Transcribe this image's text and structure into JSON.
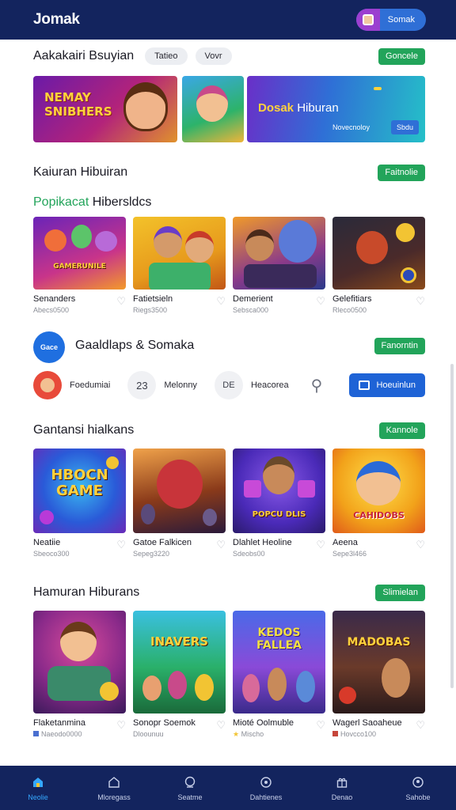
{
  "header": {
    "brand": "Jomak",
    "account_label": "Somak"
  },
  "featured": {
    "title": "Aakakairi Bsuyian",
    "chips": [
      "Tatieo",
      "Vovr"
    ],
    "button": "Goncele",
    "banner1_text": "NEMAY SNIBHERS",
    "banner3_title_a": "Dosak",
    "banner3_title_b": "Hiburan",
    "banner3_tag": "",
    "banner3_small": "Novecnoloy",
    "banner3_btn": "Sbdu"
  },
  "section_hiburan": {
    "title": "Kaiuran Hibuiran",
    "button": "Faitnolie"
  },
  "popular": {
    "title_green": "Popikacat",
    "title_rest": "Hibersldcs",
    "games": [
      {
        "name": "Senanders",
        "sub": "Abecs0500",
        "art": "GAMERUNILE"
      },
      {
        "name": "Fatietsieln",
        "sub": "Riegs3500",
        "art": ""
      },
      {
        "name": "Demerient",
        "sub": "Sebsca000",
        "art": ""
      },
      {
        "name": "Gelefitiars",
        "sub": "Rleco0500",
        "art": ""
      }
    ]
  },
  "providers": {
    "title": "Gaaldlaps & Somaka",
    "button": "Fanorntin",
    "logo_text": "Gace",
    "items": [
      {
        "label": "Foedumiai",
        "icon": ""
      },
      {
        "label": "Melonny",
        "icon": "23"
      },
      {
        "label": "Heacorea",
        "icon": "DE"
      }
    ],
    "cta": "Hoeuinlun"
  },
  "section_games": {
    "title": "Gantansi hialkans",
    "button": "Kannole",
    "games": [
      {
        "name": "Neatiie",
        "sub": "Sbeoco300",
        "art": "HBOCN GAME"
      },
      {
        "name": "Gatoe Falkicen",
        "sub": "Sepeg3220",
        "art": ""
      },
      {
        "name": "Dlahlet Heoline",
        "sub": "Sdeobs00",
        "art": "POPCU DLIS"
      },
      {
        "name": "Aeena",
        "sub": "Sepe3l466",
        "art": "CAHIDOBS"
      }
    ]
  },
  "section_more": {
    "title": "Hamuran Hiburans",
    "button": "Slimielan",
    "games": [
      {
        "name": "Flaketanmina",
        "sub": "Naeodo0000",
        "art": "",
        "sub_icon": "#4a6fd0"
      },
      {
        "name": "Sonopr Soemok",
        "sub": "Dloounuu",
        "art": "INAVERS",
        "sub_icon": ""
      },
      {
        "name": "Mioté Oolmuble",
        "sub": "Mischo",
        "art": "KEDOS FALLEA",
        "sub_icon": "#f2c433"
      },
      {
        "name": "Wagerl Saoaheue",
        "sub": "Hovcco100",
        "art": "MADOBAS",
        "sub_icon": "#c6453a"
      }
    ]
  },
  "bottom_nav": [
    {
      "label": "Neolie",
      "icon": "home-icon",
      "active": true
    },
    {
      "label": "Mloregass",
      "icon": "house-outline-icon",
      "active": false
    },
    {
      "label": "Seatme",
      "icon": "search-icon",
      "active": false
    },
    {
      "label": "Dahtienes",
      "icon": "gamepad-icon",
      "active": false
    },
    {
      "label": "Denao",
      "icon": "gift-icon",
      "active": false
    },
    {
      "label": "Sahobe",
      "icon": "profile-icon",
      "active": false
    }
  ],
  "colors": {
    "topbar": "#13245e",
    "accent_green": "#22a45a",
    "accent_blue": "#1e63d6",
    "active_nav": "#35a8ff"
  }
}
